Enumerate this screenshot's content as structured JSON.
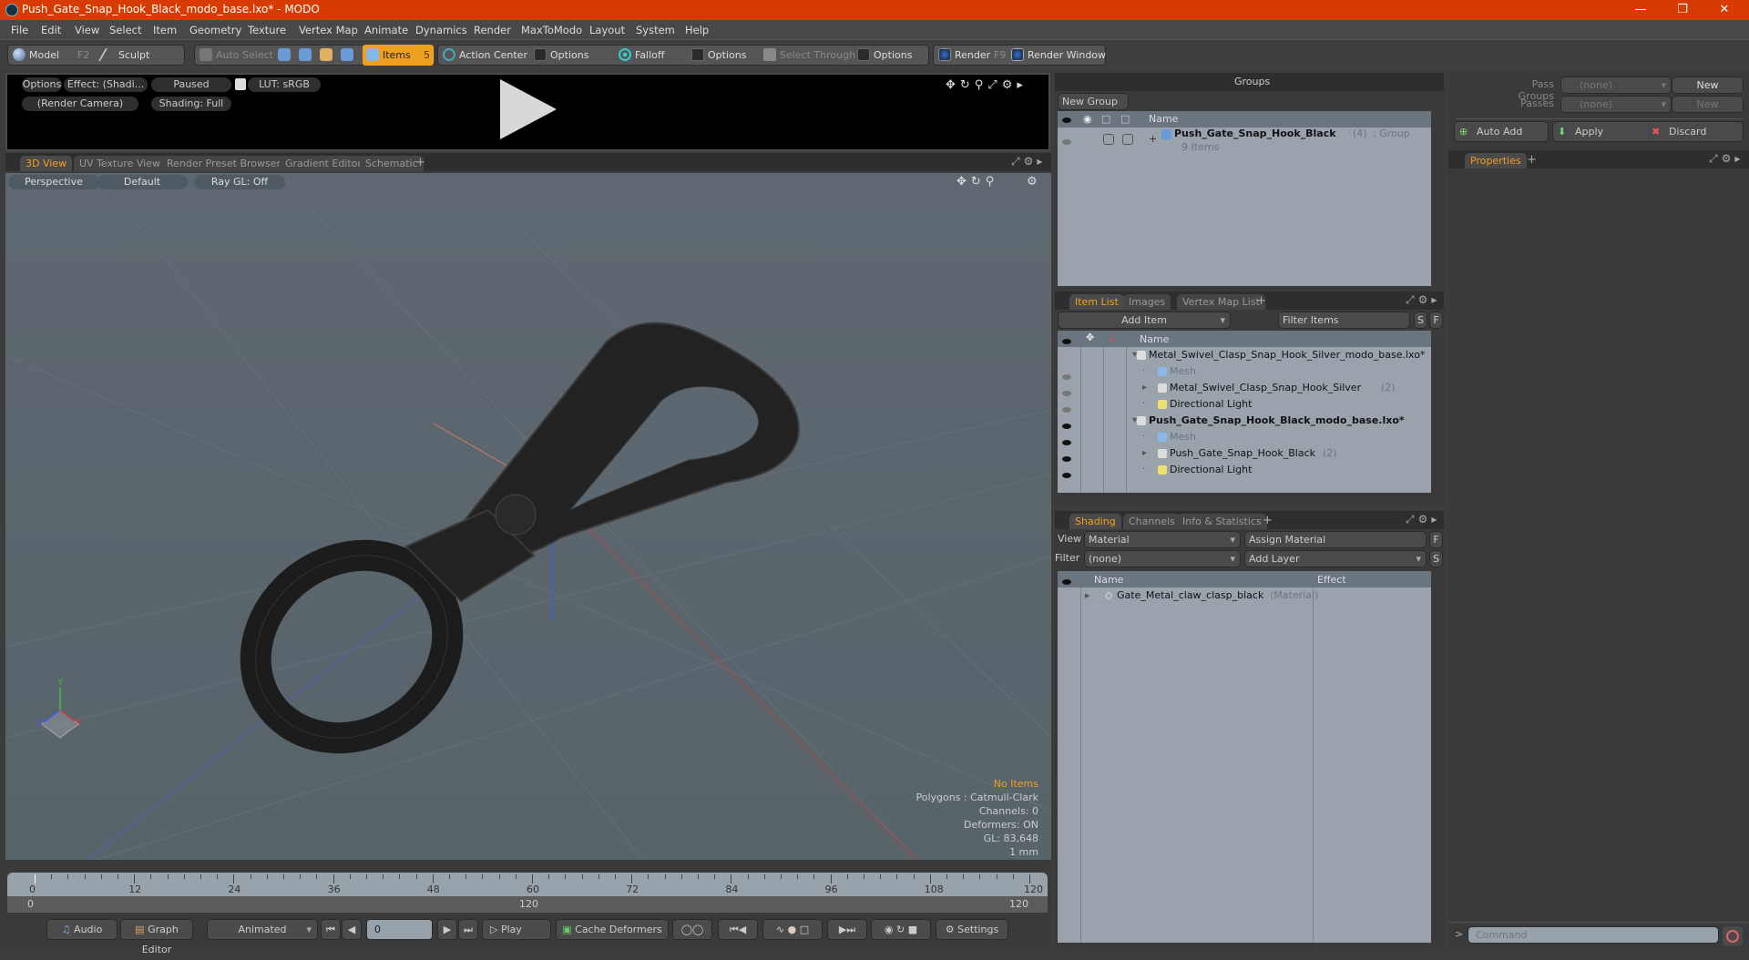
{
  "window": {
    "title": "Push_Gate_Snap_Hook_Black_modo_base.lxo* - MODO",
    "controls": [
      "minimize",
      "restore",
      "close"
    ]
  },
  "menu": [
    "File",
    "Edit",
    "View",
    "Select",
    "Item",
    "Geometry",
    "Texture",
    "Vertex Map",
    "Animate",
    "Dynamics",
    "Render",
    "MaxToModo",
    "Layout",
    "System",
    "Help"
  ],
  "toolbar": {
    "model": "Model",
    "model_key": "F2",
    "sculpt": "Sculpt",
    "auto_select": "Auto Select",
    "items": "Items",
    "items_count": "5",
    "action_center": "Action Center",
    "options1": "Options",
    "falloff": "Falloff",
    "options2": "Options",
    "select_through": "Select Through",
    "options3": "Options",
    "render": "Render",
    "render_key": "F9",
    "render_window": "Render Window"
  },
  "preview": {
    "options": "Options",
    "effect": "Effect: (Shadi...",
    "paused": "Paused",
    "lut": "LUT: sRGB",
    "camera": "(Render Camera)",
    "shading": "Shading: Full"
  },
  "viewport_tabs": [
    "3D View",
    "UV Texture View",
    "Render Preset Browser",
    "Gradient Editor",
    "Schematic"
  ],
  "viewport": {
    "perspective": "Perspective",
    "default": "Default",
    "raygl": "Ray GL: Off",
    "info": {
      "selection": "No Items",
      "polygons": "Polygons : Catmull-Clark",
      "channels": "Channels: 0",
      "deformers": "Deformers: ON",
      "gl": "GL: 83,648",
      "unit": "1 mm"
    },
    "axis_labels": {
      "x": "X",
      "y": "Y",
      "z": "Z"
    }
  },
  "timeline": {
    "ticks": [
      "0",
      "12",
      "24",
      "36",
      "48",
      "60",
      "72",
      "84",
      "96",
      "108",
      "120"
    ],
    "range_start": "0",
    "range_mid": "120",
    "range_end": "120"
  },
  "transport": {
    "audio": "Audio",
    "graph_editor": "Graph Editor",
    "animated": "Animated",
    "frame": "0",
    "play": "Play",
    "cache_deformers": "Cache Deformers",
    "settings": "Settings"
  },
  "groups": {
    "title": "Groups",
    "new_group": "New Group",
    "col_name": "Name",
    "item_name": "Push_Gate_Snap_Hook_Black",
    "item_count": "(4)",
    "item_type": ": Group",
    "item_sub": "9 Items"
  },
  "pass": {
    "pass_groups_label": "Pass Groups",
    "pass_groups_value": "(none)",
    "passes_label": "Passes",
    "passes_value": "(none)",
    "new1": "New",
    "new2": "New",
    "auto_add": "Auto Add",
    "apply": "Apply",
    "discard": "Discard",
    "properties_tab": "Properties"
  },
  "itemlist": {
    "tabs": [
      "Item List",
      "Images",
      "Vertex Map List"
    ],
    "add_item": "Add Item",
    "filter": "Filter Items",
    "s": "S",
    "f": "F",
    "col_name": "Name",
    "rows": [
      {
        "name": "Metal_Swivel_Clasp_Snap_Hook_Silver_modo_base.lxo*",
        "count": "",
        "bold": false,
        "indent": 0,
        "icon": "scene-icon"
      },
      {
        "name": "Mesh",
        "count": "",
        "bold": false,
        "indent": 1,
        "icon": "mesh-icon",
        "dim": true
      },
      {
        "name": "Metal_Swivel_Clasp_Snap_Hook_Silver",
        "count": "(2)",
        "bold": false,
        "indent": 1,
        "icon": "folder-icon"
      },
      {
        "name": "Directional Light",
        "count": "",
        "bold": false,
        "indent": 1,
        "icon": "light-icon"
      },
      {
        "name": "Push_Gate_Snap_Hook_Black_modo_base.lxo*",
        "count": "",
        "bold": true,
        "indent": 0,
        "icon": "scene-icon"
      },
      {
        "name": "Mesh",
        "count": "",
        "bold": false,
        "indent": 1,
        "icon": "mesh-icon",
        "dim": true
      },
      {
        "name": "Push_Gate_Snap_Hook_Black",
        "count": "(2)",
        "bold": false,
        "indent": 1,
        "icon": "folder-icon"
      },
      {
        "name": "Directional Light",
        "count": "",
        "bold": false,
        "indent": 1,
        "icon": "light-icon"
      }
    ]
  },
  "shading": {
    "tabs": [
      "Shading",
      "Channels",
      "Info & Statistics"
    ],
    "view_label": "View",
    "view_value": "Material",
    "assign": "Assign Material",
    "filter_label": "Filter",
    "filter_value": "(none)",
    "add_layer": "Add Layer",
    "f": "F",
    "s": "S",
    "col_name": "Name",
    "col_effect": "Effect",
    "row_name": "Gate_Metal_claw_clasp_black",
    "row_type": "(Material)"
  },
  "command": {
    "placeholder": "Command",
    "prompt": ">"
  },
  "colors": {
    "accent": "#f0a020",
    "titlebar": "#d83b01"
  }
}
